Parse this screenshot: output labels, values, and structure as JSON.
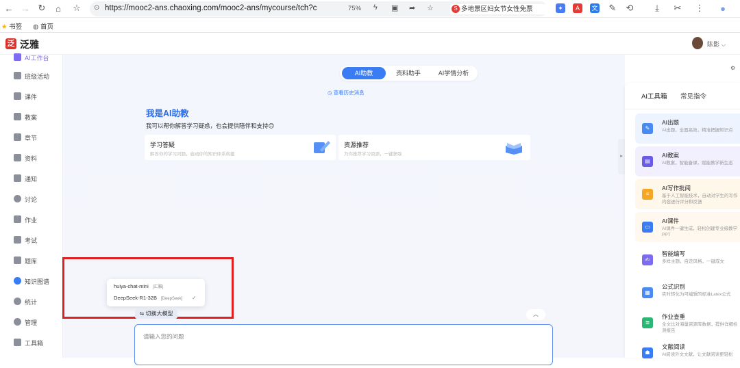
{
  "browser": {
    "url": "https://mooc2-ans.chaoxing.com/mooc2-ans/mycourse/tch?cours",
    "zoom": "75%",
    "tab_search": "多地景区妇女节女性免票",
    "colors": {
      "accent": "#3a7cf3",
      "brand": "#e0322d"
    }
  },
  "bookmarks": [
    {
      "label": "书签",
      "icon": "star-icon"
    },
    {
      "label": "首页",
      "icon": "globe-icon"
    }
  ],
  "app": {
    "logo": "泛雅",
    "user_name": "陈影"
  },
  "sidebar": {
    "top_label": "AI工作台",
    "items": [
      {
        "label": "班级活动",
        "icon": "grid-icon"
      },
      {
        "label": "课件",
        "icon": "file-icon"
      },
      {
        "label": "教案",
        "icon": "doc-icon"
      },
      {
        "label": "章节",
        "icon": "list-icon"
      },
      {
        "label": "资料",
        "icon": "folder-icon"
      },
      {
        "label": "通知",
        "icon": "speaker-icon"
      },
      {
        "label": "讨论",
        "icon": "chat-icon"
      },
      {
        "label": "作业",
        "icon": "edit-icon"
      },
      {
        "label": "考试",
        "icon": "exam-icon"
      },
      {
        "label": "题库",
        "icon": "layers-icon"
      },
      {
        "label": "知识图谱",
        "icon": "graph-icon"
      },
      {
        "label": "统计",
        "icon": "pie-icon"
      },
      {
        "label": "管理",
        "icon": "gear-icon"
      },
      {
        "label": "工具箱",
        "icon": "toolbox-icon"
      }
    ]
  },
  "main": {
    "tabs": [
      {
        "label": "AI助教",
        "active": true
      },
      {
        "label": "资料助手",
        "active": false
      },
      {
        "label": "AI学情分析",
        "active": false
      }
    ],
    "history_link": "查看历史消息",
    "title": "我是AI助教",
    "description": "我可以帮你解答学习疑惑，也会提供陪伴和支持😊",
    "cards": [
      {
        "title": "学习答疑",
        "subtitle": "解答你的学习问题，启动你的知识体系构建",
        "icon": "pen-icon"
      },
      {
        "title": "资源推荐",
        "subtitle": "为你推荐学习资源，一键获取",
        "icon": "book-icon"
      }
    ],
    "model_options": [
      {
        "name": "huiya-chat-mini",
        "tag": "[汇雅]",
        "selected": false
      },
      {
        "name": "DeepSeek-R1-32B",
        "tag": "[DeepSeek]",
        "selected": true
      }
    ],
    "switch_model_label": "切换大模型",
    "input_placeholder": "请输入您的问题"
  },
  "right_panel": {
    "tabs": [
      "AI工具箱",
      "常见指令"
    ],
    "tools": [
      {
        "title": "AI出题",
        "desc": "AI出题，全面高效，精准把握知识点",
        "color": "#4a8af4",
        "bg": "#eef4ff"
      },
      {
        "title": "AI教案",
        "desc": "AI教案，智能备课，赋能教学新生态",
        "color": "#6b5ce7",
        "bg": "#f2f0ff"
      },
      {
        "title": "AI写作批阅",
        "desc": "基于人工智能技术，自动对学生的写作内容进行评分和反馈",
        "color": "#f5a623",
        "bg": "#fff7ea"
      },
      {
        "title": "AI课件",
        "desc": "AI课件一键生成，轻松创建专业级教学PPT",
        "color": "#3a7cf3",
        "bg": "#fff8ee"
      },
      {
        "title": "智能编写",
        "desc": "多样主题，自定风格，一键成文",
        "color": "#7c6cf0",
        "bg": "#ffffff"
      },
      {
        "title": "公式识别",
        "desc": "实时转化为可编辑的标准Latex公式",
        "color": "#4a8af4",
        "bg": "#ffffff"
      },
      {
        "title": "作业查重",
        "desc": "全文比对海量资源库数据，提供详细检测报告",
        "color": "#2bb673",
        "bg": "#ffffff"
      },
      {
        "title": "文献阅读",
        "desc": "AI阅读外文文献，让文献阅读更轻松",
        "color": "#3a7cf3",
        "bg": "#ffffff"
      }
    ]
  }
}
